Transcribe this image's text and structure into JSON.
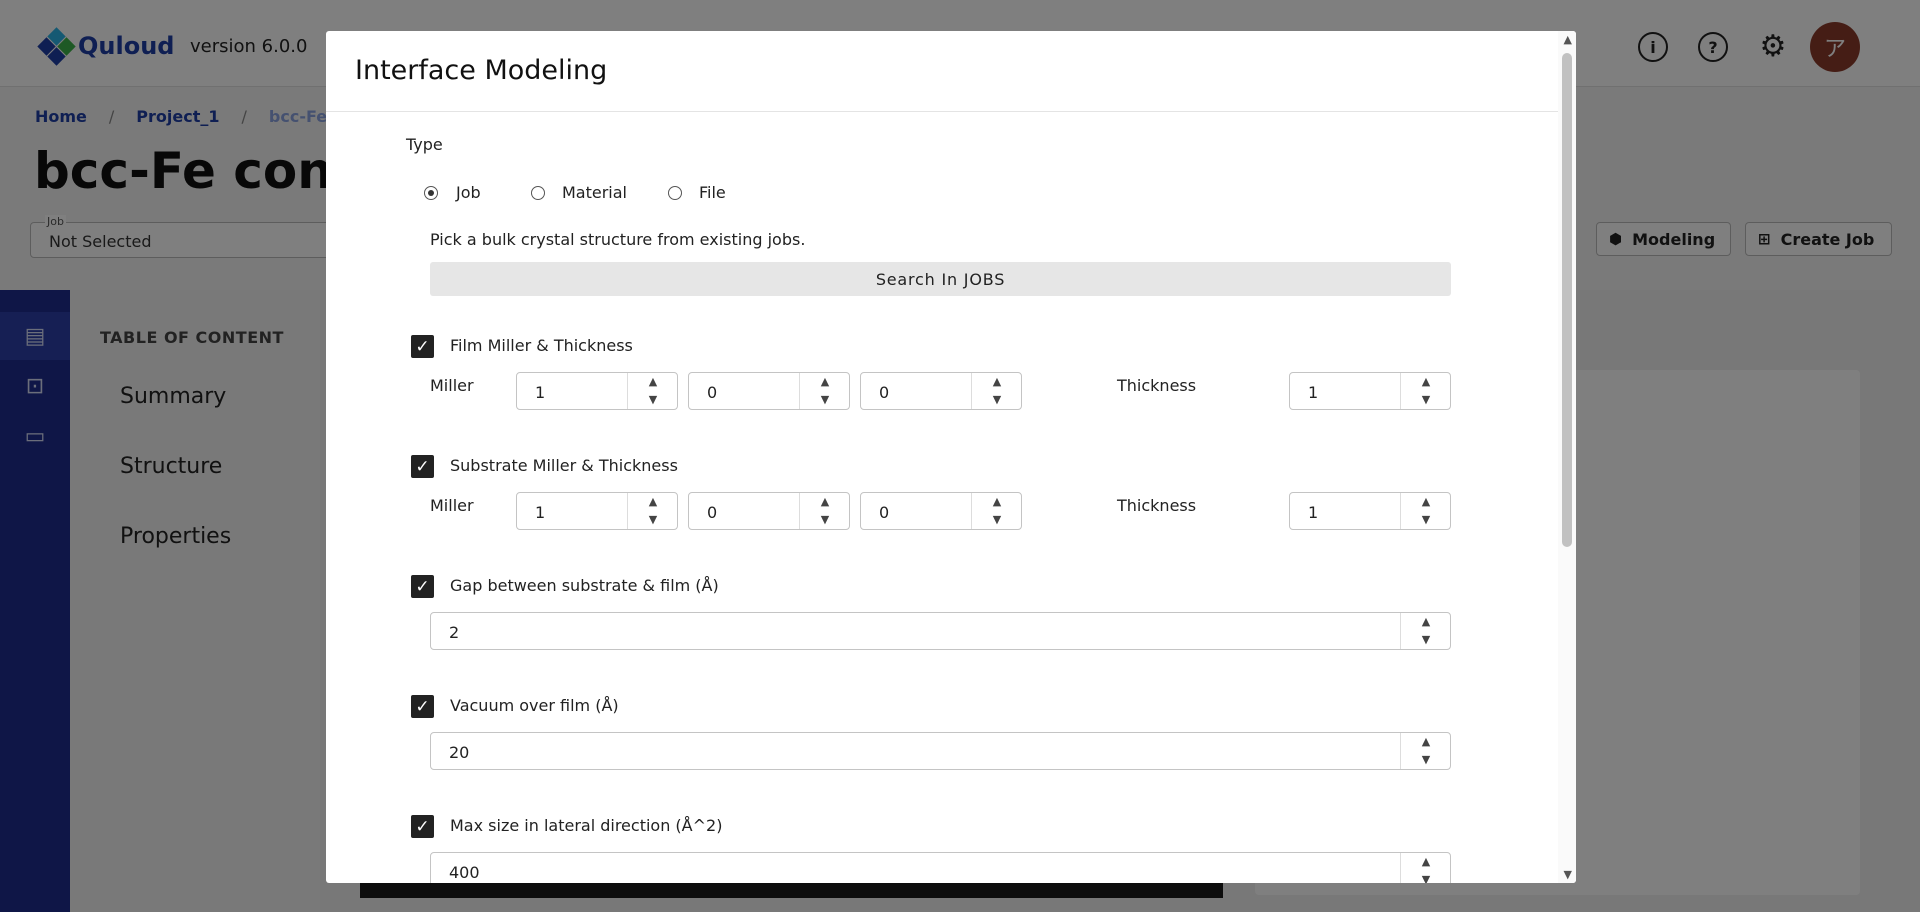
{
  "app": {
    "logo_text": "Quloud",
    "version": "version 6.0.0",
    "avatar_initial": "ア"
  },
  "breadcrumb": [
    "Home",
    "Project_1",
    "bcc-Fe co"
  ],
  "page_title": "bcc-Fe conver",
  "job_select": {
    "label": "Job",
    "value": "Not Selected"
  },
  "actions": {
    "modeling": "Modeling",
    "create_job": "Create Job"
  },
  "toc": {
    "title": "TABLE OF CONTENT",
    "items": [
      "Summary",
      "Structure",
      "Properties"
    ]
  },
  "modal": {
    "title": "Interface Modeling",
    "type_label": "Type",
    "type_options": [
      "Job",
      "Material",
      "File"
    ],
    "type_selected": "Job",
    "hint": "Pick a bulk crystal structure from existing jobs.",
    "search_button": "Search In JOBS",
    "film": {
      "label": "Film Miller & Thickness",
      "checked": true,
      "miller_label": "Miller",
      "miller": [
        "1",
        "0",
        "0"
      ],
      "thickness_label": "Thickness",
      "thickness": "1"
    },
    "substrate": {
      "label": "Substrate Miller & Thickness",
      "checked": true,
      "miller_label": "Miller",
      "miller": [
        "1",
        "0",
        "0"
      ],
      "thickness_label": "Thickness",
      "thickness": "1"
    },
    "gap": {
      "label": "Gap between substrate & film (Å)",
      "checked": true,
      "value": "2"
    },
    "vacuum": {
      "label": "Vacuum over film (Å)",
      "checked": true,
      "value": "20"
    },
    "max_size": {
      "label": "Max size in lateral direction (Å^2)",
      "checked": true,
      "value": "400"
    }
  },
  "colors": {
    "brand": "#1f3fa6",
    "sidenav": "#1f2d8f",
    "avatar": "#8b3a2b",
    "checkbox": "#222222"
  }
}
